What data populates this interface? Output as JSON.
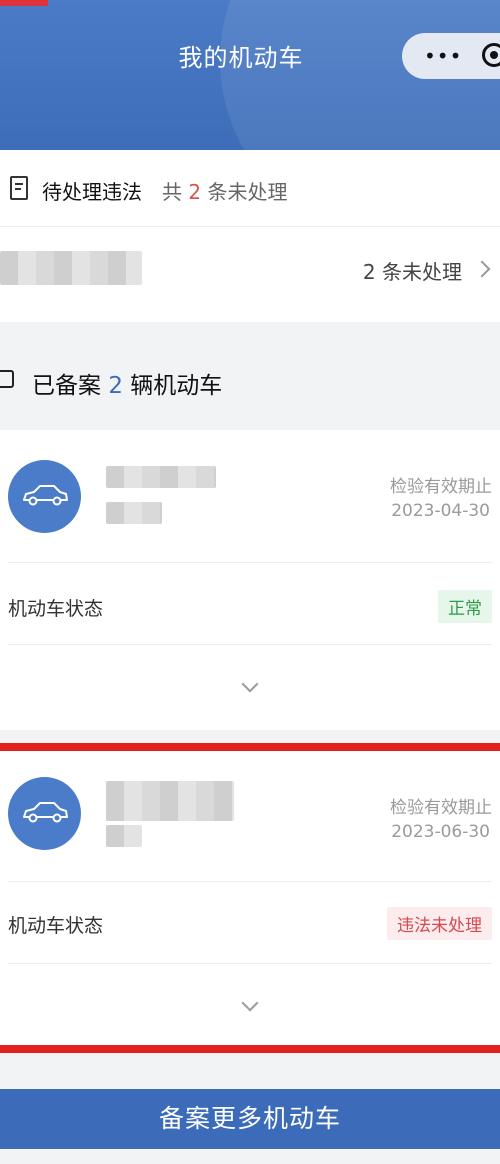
{
  "header": {
    "title": "我的机动车",
    "capsule": {
      "more_icon": "ellipsis-icon",
      "close_icon": "target-icon"
    }
  },
  "violations": {
    "title": "待处理违法",
    "summary_prefix": "共",
    "summary_count": "2",
    "summary_suffix": "条未处理",
    "row_pending": "2 条未处理"
  },
  "fleet": {
    "title_prefix": "已备案",
    "count": "2",
    "title_suffix": "辆机动车"
  },
  "vehicles": [
    {
      "valid_label": "检验有效期止",
      "valid_date": "2023-04-30",
      "state_label": "机动车状态",
      "state_value": "正常",
      "state_color": "#2f9b4d"
    },
    {
      "valid_label": "检验有效期止",
      "valid_date": "2023-06-30",
      "state_label": "机动车状态",
      "state_value": "违法未处理",
      "state_color": "#d44a4f"
    }
  ],
  "colors": {
    "brand_blue": "#3c6cb9",
    "highlight_red": "#e3211c"
  },
  "bottom_button": "备案更多机动车"
}
